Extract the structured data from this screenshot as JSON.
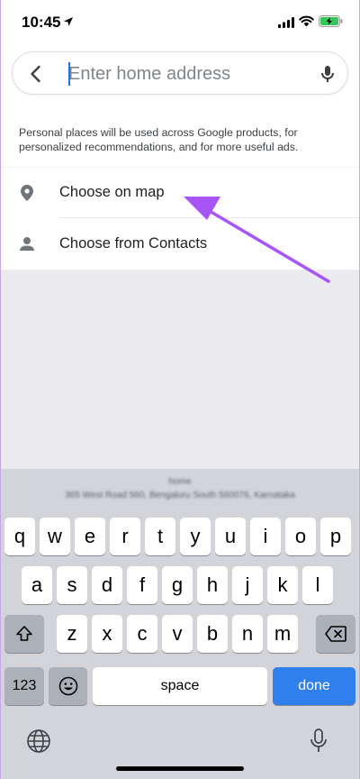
{
  "status_bar": {
    "time": "10:45"
  },
  "search": {
    "placeholder": "Enter home address",
    "value": ""
  },
  "info": {
    "text": "Personal places will be used across Google products, for personalized recommendations, and for more useful ads."
  },
  "options": [
    {
      "label": "Choose on map",
      "icon": "location-pin-icon"
    },
    {
      "label": "Choose from Contacts",
      "icon": "person-icon"
    }
  ],
  "keyboard": {
    "suggestion_title": "home",
    "suggestion_sub": "365 West Road 560, Bengaluru South 560076, Karnataka",
    "row1": [
      "q",
      "w",
      "e",
      "r",
      "t",
      "y",
      "u",
      "i",
      "o",
      "p"
    ],
    "row2": [
      "a",
      "s",
      "d",
      "f",
      "g",
      "h",
      "j",
      "k",
      "l"
    ],
    "row3": [
      "z",
      "x",
      "c",
      "v",
      "b",
      "n",
      "m"
    ],
    "num_label": "123",
    "space_label": "space",
    "done_label": "done"
  },
  "colors": {
    "accent": "#1a73e8",
    "annotation_arrow": "#a855f7",
    "done_key": "#2f80ed"
  }
}
